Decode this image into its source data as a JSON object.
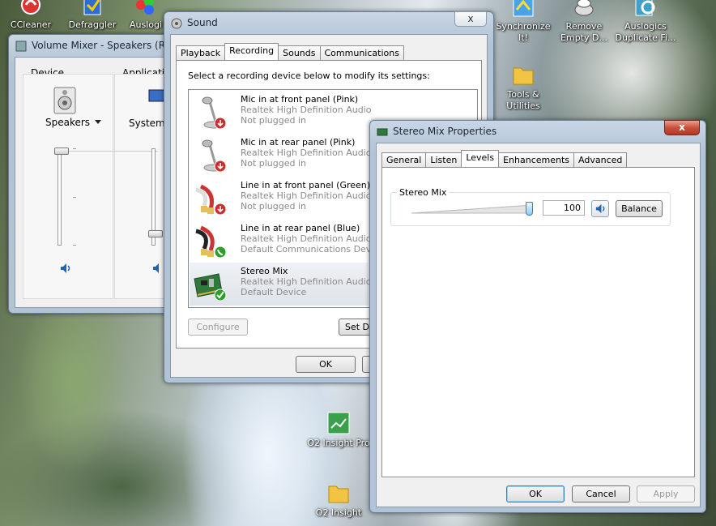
{
  "desktop": {
    "icons": [
      {
        "label": "CCleaner"
      },
      {
        "label": "Defraggler"
      },
      {
        "label": "Auslogi"
      },
      {
        "label": "Synchronize It!"
      },
      {
        "label": "Remove Empty D..."
      },
      {
        "label": "Auslogics Duplicate Fi..."
      },
      {
        "label": "Tools & Utilities"
      },
      {
        "label": "O2 Insight Pro"
      },
      {
        "label": "O2 Insight"
      }
    ]
  },
  "volume_mixer": {
    "title": "Volume Mixer - Speakers (Real",
    "device_label": "Device",
    "device_name": "Speakers",
    "apps_label": "Applicatio",
    "app_name": "System S"
  },
  "sound": {
    "title": "Sound",
    "close_label": "x",
    "tabs": [
      "Playback",
      "Recording",
      "Sounds",
      "Communications"
    ],
    "active_tab": "Recording",
    "instruction": "Select a recording device below to modify its settings:",
    "devices": [
      {
        "name": "Mic in at front panel (Pink)",
        "driver": "Realtek High Definition Audio",
        "status": "Not plugged in"
      },
      {
        "name": "Mic in at rear panel (Pink)",
        "driver": "Realtek High Definition Audio",
        "status": "Not plugged in"
      },
      {
        "name": "Line in at front panel (Green)",
        "driver": "Realtek High Definition Audio",
        "status": "Not plugged in"
      },
      {
        "name": "Line in at rear panel (Blue)",
        "driver": "Realtek High Definition Audio",
        "status": "Default Communications Device"
      },
      {
        "name": "Stereo Mix",
        "driver": "Realtek High Definition Audio",
        "status": "Default Device"
      }
    ],
    "configure_label": "Configure",
    "set_default_label": "Set De",
    "ok_label": "OK"
  },
  "properties": {
    "title": "Stereo Mix Properties",
    "close_label": "x",
    "tabs": [
      "General",
      "Listen",
      "Levels",
      "Enhancements",
      "Advanced"
    ],
    "active_tab": "Levels",
    "group_label": "Stereo Mix",
    "level_value": "100",
    "level_fraction": 1.0,
    "balance_label": "Balance",
    "ok_label": "OK",
    "cancel_label": "Cancel",
    "apply_label": "Apply"
  },
  "colors": {
    "title_glass": "#b2c3d6",
    "close_red": "#c8513c",
    "default_button_border": "#3c7fb1",
    "status_green": "#2aa02a"
  }
}
